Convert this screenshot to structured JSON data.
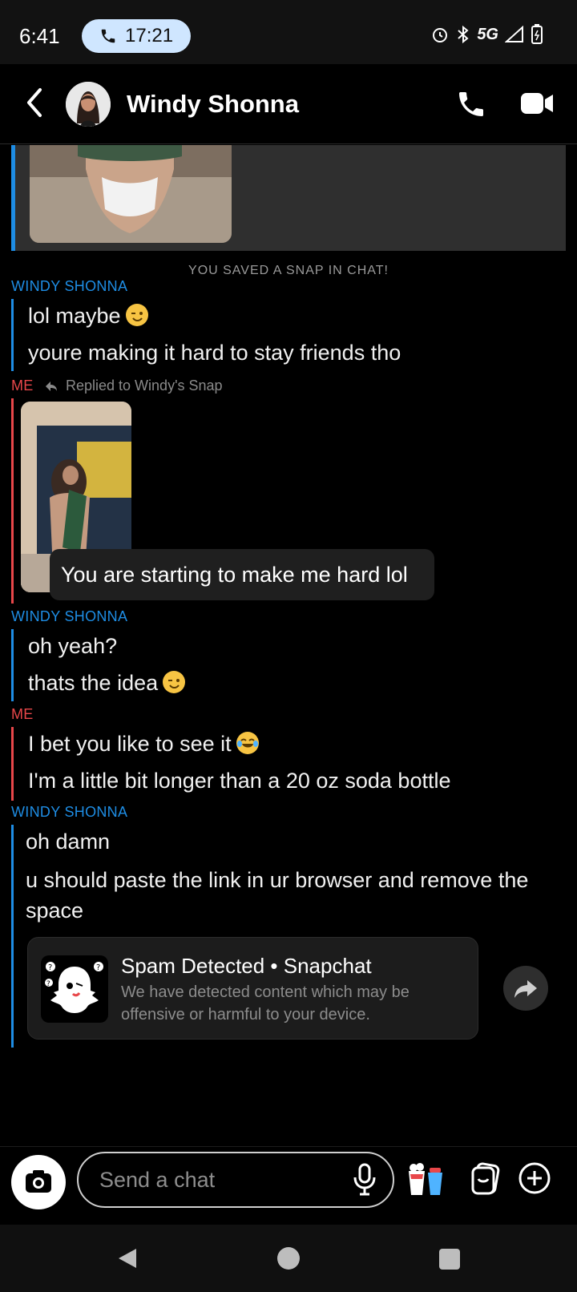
{
  "status_bar": {
    "time": "6:41",
    "call_duration": "17:21",
    "network": "5G",
    "icons": [
      "alarm-icon",
      "bluetooth-icon",
      "signal-icon",
      "battery-icon"
    ]
  },
  "header": {
    "contact_name": "Windy Shonna",
    "icons": [
      "back-icon",
      "call-icon",
      "video-call-icon"
    ]
  },
  "chat": {
    "system_note": "YOU SAVED A SNAP IN CHAT!",
    "groups": [
      {
        "sender": "WINDY SHONNA",
        "messages": [
          "lol maybe",
          "youre making it hard to stay friends tho"
        ]
      },
      {
        "sender": "ME",
        "reply_note": "Replied to Windy's Snap",
        "messages": [
          "You are starting to make me hard lol"
        ]
      },
      {
        "sender": "WINDY SHONNA",
        "messages": [
          "oh yeah?",
          "thats the idea"
        ]
      },
      {
        "sender": "ME",
        "messages": [
          "I bet you like to see it",
          "I'm a little bit longer than a 20 oz soda bottle"
        ]
      },
      {
        "sender": "WINDY SHONNA",
        "messages": [
          "oh damn",
          "u should paste the link in ur browser and remove the space"
        ]
      }
    ],
    "spam_card": {
      "title": "Spam Detected • Snapchat",
      "description": "We have detected content which may be offensive or harmful to your device."
    }
  },
  "input_bar": {
    "placeholder": "Send a chat"
  },
  "colors": {
    "windy": "#1e8de4",
    "me": "#e8474a",
    "background": "#000000"
  }
}
